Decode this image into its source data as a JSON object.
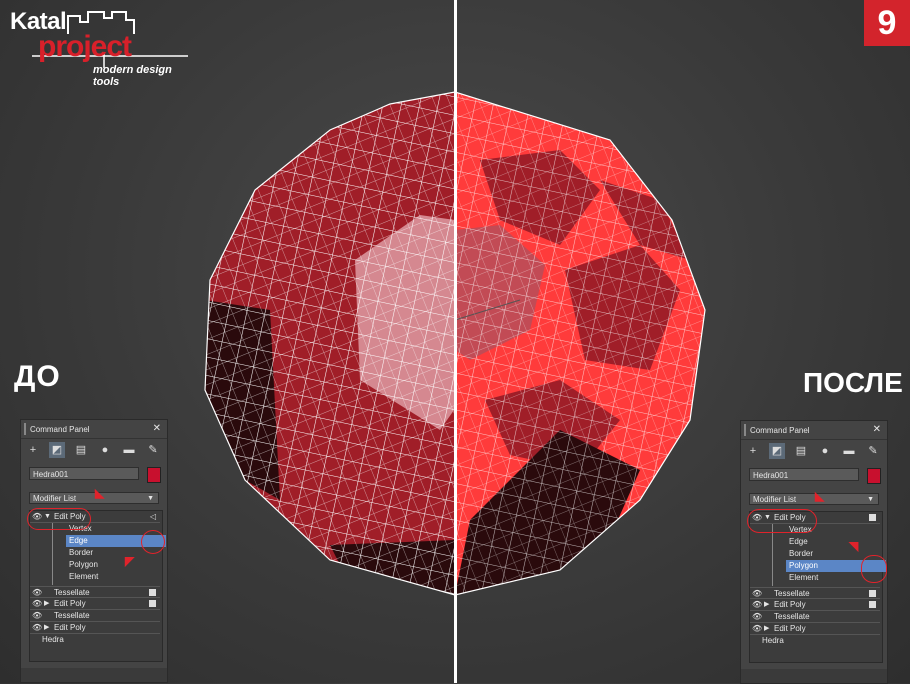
{
  "logo": {
    "line1": "Katal",
    "line2": "project",
    "tagline": "modern design tools"
  },
  "step_number": "9",
  "labels": {
    "before": "ДО",
    "after": "ПОСЛЕ"
  },
  "colors": {
    "accent": "#d3242c",
    "mesh_red": "#a5202a",
    "highlight_red": "#ff3a3a",
    "selection_blue": "#5b86c6"
  },
  "panel_left": {
    "title": "Command Panel",
    "close": "✕",
    "object_name": "Hedra001",
    "modifier_list": "Modifier List",
    "stack": {
      "top": "Edit Poly",
      "subobjects": [
        "Vertex",
        "Edge",
        "Border",
        "Polygon",
        "Element"
      ],
      "selected_subobject": "Edge",
      "rows": [
        "Tessellate",
        "Edit Poly",
        "Tessellate",
        "Edit Poly"
      ],
      "base": "Hedra"
    }
  },
  "panel_right": {
    "title": "Command Panel",
    "close": "✕",
    "object_name": "Hedra001",
    "modifier_list": "Modifier List",
    "stack": {
      "top": "Edit Poly",
      "subobjects": [
        "Vertex",
        "Edge",
        "Border",
        "Polygon",
        "Element"
      ],
      "selected_subobject": "Polygon",
      "rows": [
        "Tessellate",
        "Edit Poly",
        "Tessellate",
        "Edit Poly"
      ],
      "base": "Hedra"
    }
  },
  "icons": [
    "plus-icon",
    "modify-icon",
    "hierarchy-icon",
    "motion-icon",
    "display-icon",
    "utilities-icon",
    "eye-icon"
  ]
}
